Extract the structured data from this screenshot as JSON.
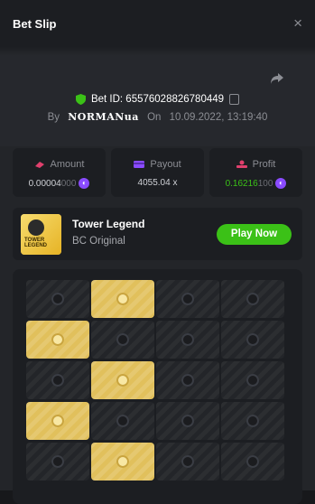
{
  "header": {
    "title": "Bet Slip",
    "close": "×"
  },
  "bet": {
    "id_label": "Bet ID: 65576028826780449",
    "by_label": "By",
    "user": "NORMANua",
    "on_label": "On",
    "date": "10.09.2022, 13:19:40"
  },
  "stats": [
    {
      "label": "Amount",
      "value_main": "0.00004",
      "value_dim": "000",
      "icon": "amount-icon"
    },
    {
      "label": "Payout",
      "value_main": "4055.04 x",
      "value_dim": "",
      "icon": "payout-icon"
    },
    {
      "label": "Profit",
      "value_main": "0.16216",
      "value_dim": "100",
      "icon": "profit-icon"
    }
  ],
  "game": {
    "name": "Tower Legend",
    "sub": "BC Original",
    "button": "Play Now",
    "thumb_text_1": "TOWER",
    "thumb_text_2": "LEGEND"
  },
  "board": {
    "rows": [
      [
        "dark",
        "gold",
        "dark",
        "dark"
      ],
      [
        "gold",
        "dark",
        "dark",
        "dark"
      ],
      [
        "dark",
        "gold",
        "dark",
        "dark"
      ],
      [
        "gold",
        "dark",
        "dark",
        "dark"
      ],
      [
        "dark",
        "gold",
        "dark",
        "dark"
      ]
    ]
  },
  "colors": {
    "accent_green": "#3bc117",
    "gold": "#e1c05c",
    "coin": "#8a4bff"
  }
}
